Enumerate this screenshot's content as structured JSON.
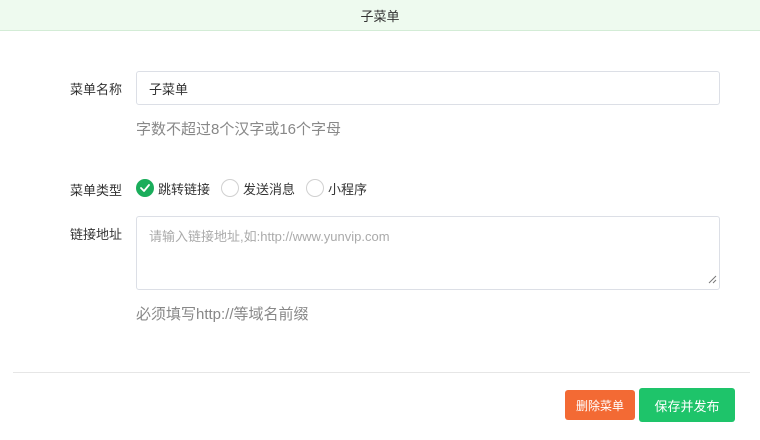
{
  "header": {
    "title": "子菜单"
  },
  "form": {
    "name_label": "菜单名称",
    "name_value": "子菜单",
    "name_hint": "字数不超过8个汉字或16个字母",
    "type_label": "菜单类型",
    "type_options": [
      {
        "label": "跳转链接",
        "checked": true
      },
      {
        "label": "发送消息",
        "checked": false
      },
      {
        "label": "小程序",
        "checked": false
      }
    ],
    "url_label": "链接地址",
    "url_placeholder": "请输入链接地址,如:http://www.yunvip.com",
    "url_hint": "必须填写http://等域名前缀"
  },
  "actions": {
    "delete_label": "删除菜单",
    "save_label": "保存并发布"
  },
  "colors": {
    "accent_green": "#1ec46a",
    "danger_orange": "#f36a34",
    "header_bg": "#eefaef"
  }
}
